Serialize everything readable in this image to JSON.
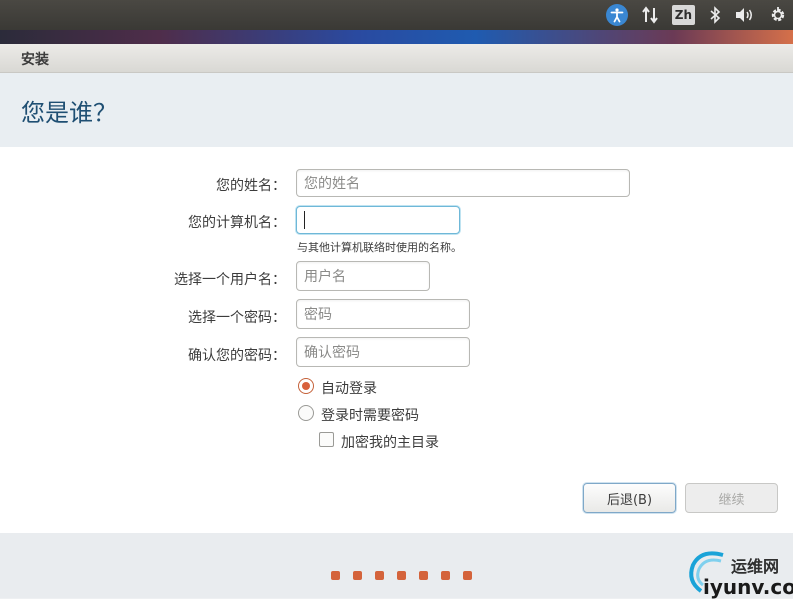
{
  "panel": {
    "indicators": [
      {
        "name": "accessibility-icon",
        "glyph": "☺"
      },
      {
        "name": "network-icon",
        "glyph": "⇅"
      },
      {
        "name": "keyboard-layout",
        "label": "Zh"
      },
      {
        "name": "bluetooth-icon",
        "glyph": "ᛒ"
      },
      {
        "name": "volume-icon",
        "glyph": "🔊"
      },
      {
        "name": "gear-icon",
        "glyph": "⚙"
      }
    ],
    "keyboard_label": "Zh"
  },
  "window": {
    "title": "安装"
  },
  "header": {
    "title": "您是谁？"
  },
  "form": {
    "name_label": "您的姓名：",
    "name_placeholder": "您的姓名",
    "computer_label": "您的计算机名：",
    "computer_value": "",
    "computer_hint": "与其他计算机联络时使用的名称。",
    "username_label": "选择一个用户名：",
    "username_placeholder": "用户名",
    "password_label": "选择一个密码：",
    "password_placeholder": "密码",
    "confirm_label": "确认您的密码：",
    "confirm_placeholder": "确认密码",
    "auto_login_label": "自动登录",
    "require_password_label": "登录时需要密码",
    "encrypt_home_label": "加密我的主目录",
    "login_mode": "auto_login",
    "encrypt_home_checked": false
  },
  "buttons": {
    "back_label": "后退(B)",
    "continue_label": "继续"
  },
  "footer": {
    "progress_dots": 7,
    "watermark_cn": "运维网",
    "watermark_en": "iyunv.com"
  },
  "colors": {
    "accent": "#d8613c",
    "header_title": "#1f4f73"
  }
}
